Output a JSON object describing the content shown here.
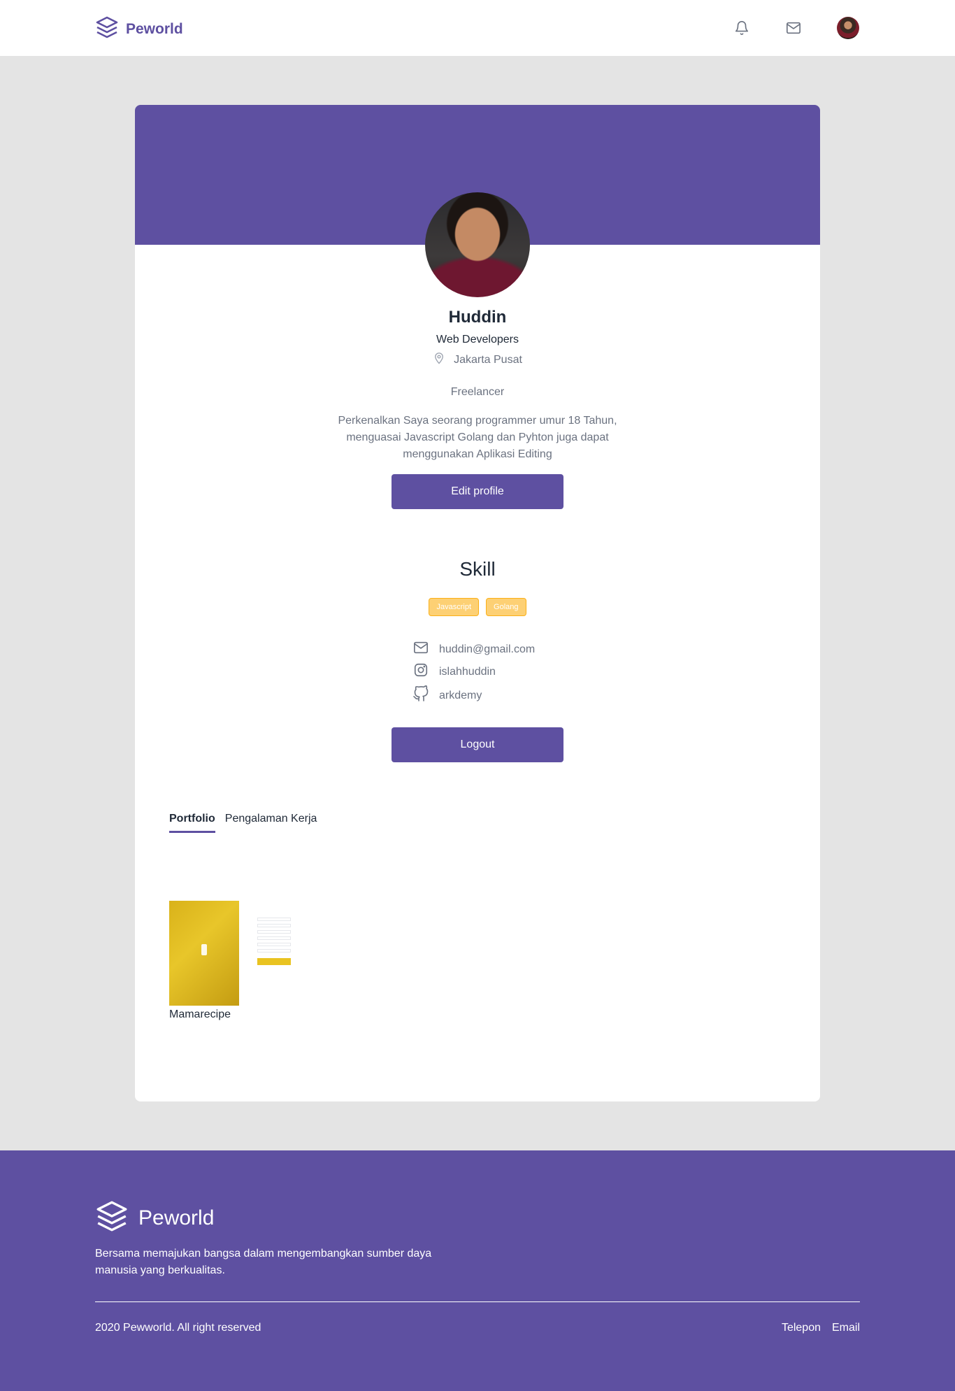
{
  "header": {
    "brand": "Peworld"
  },
  "profile": {
    "name": "Huddin",
    "job": "Web Developers",
    "location": "Jakarta Pusat",
    "status": "Freelancer",
    "description": "Perkenalkan Saya seorang programmer umur 18 Tahun, menguasai Javascript Golang dan Pyhton juga dapat menggunakan Aplikasi Editing",
    "edit_label": "Edit profile"
  },
  "skills": {
    "title": "Skill",
    "items": [
      "Javascript",
      "Golang"
    ]
  },
  "contacts": {
    "email": "huddin@gmail.com",
    "instagram": "islahhuddin",
    "github": "arkdemy"
  },
  "logout_label": "Logout",
  "tabs": [
    {
      "label": "Portfolio",
      "active": true
    },
    {
      "label": "Pengalaman Kerja",
      "active": false
    }
  ],
  "portfolio": {
    "items": [
      {
        "title": "Mamarecipe"
      }
    ]
  },
  "footer": {
    "brand": "Peworld",
    "tagline": "Bersama memajukan bangsa dalam mengembangkan sumber daya manusia yang berkualitas.",
    "copyright": "2020 Pewworld. All right reserved",
    "links": [
      "Telepon",
      "Email"
    ]
  },
  "colors": {
    "primary": "#5e50a1",
    "skill_tag": "#fbb017",
    "background": "#e4e4e4"
  }
}
